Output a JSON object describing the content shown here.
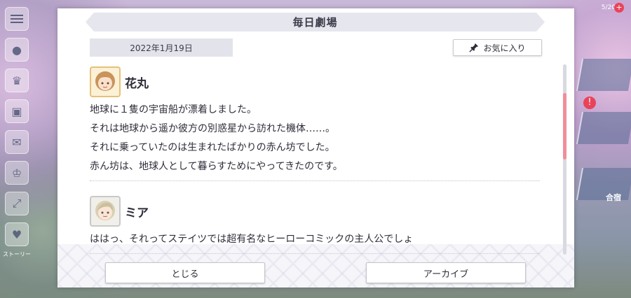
{
  "dialog": {
    "title": "毎日劇場",
    "date": "2022年1月19日",
    "favorite_label": "お気に入り",
    "close_label": "とじる",
    "archive_label": "アーカイブ"
  },
  "entries": [
    {
      "speaker": "花丸",
      "lines": [
        "地球に１隻の宇宙船が漂着しました。",
        "それは地球から遥か彼方の別惑星から訪れた機体……。",
        "それに乗っていたのは生まれたばかりの赤ん坊でした。",
        "赤ん坊は、地球人として暮らすためにやってきたのです。"
      ]
    },
    {
      "speaker": "ミア",
      "lines": [
        "ははっ、それってステイツでは超有名なヒーローコミックの主人公でしょ"
      ]
    }
  ],
  "background": {
    "right_top_text": "5/20",
    "right_label": "合宿",
    "left_label": "ストーリー"
  },
  "scroll": {
    "position_fraction": 0.23,
    "visible_fraction": 0.35
  },
  "colors": {
    "accent_scroll": "#f08f9a",
    "title_bar": "#e6e6ee",
    "text": "#2e2e3a"
  },
  "icons": [
    "menu-icon",
    "pin-icon",
    "avatar-hanamaru",
    "avatar-mia"
  ]
}
